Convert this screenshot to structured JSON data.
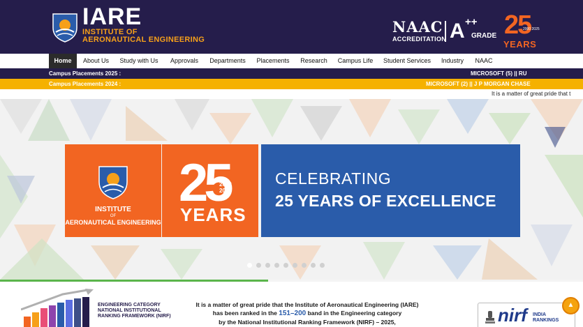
{
  "header": {
    "logo_small": "IARE",
    "logo_title": "IARE",
    "logo_line1": "INSTITUTE OF",
    "logo_line2": "AERONAUTICAL ENGINEERING",
    "naac": "NAAC",
    "naac_sub": "ACCREDITATION",
    "grade_letter": "A",
    "grade_plus": "++",
    "grade_label": "GRADE",
    "anniv_number": "25",
    "anniv_range": "2000 2025",
    "anniv_word": "YEARS"
  },
  "nav": {
    "items": [
      {
        "label": "Home",
        "active": true
      },
      {
        "label": "About Us"
      },
      {
        "label": "Study with Us"
      },
      {
        "label": "Approvals"
      },
      {
        "label": "Departments"
      },
      {
        "label": "Placements"
      },
      {
        "label": "Research"
      },
      {
        "label": "Campus Life"
      },
      {
        "label": "Student Services"
      },
      {
        "label": "Industry"
      },
      {
        "label": "NAAC"
      }
    ]
  },
  "tickers": {
    "t2025_label": "Campus Placements 2025 :",
    "t2025_text": "MICROSOFT (5)   ||   RU",
    "t2024_label_prefix": "Campus Placements ",
    "t2024_label_year": "2024",
    "t2024_label_suffix": " :",
    "t2024_text": "MICROSOFT (2)   ||   J P MORGAN CHASE"
  },
  "marquee": {
    "text": "It is a matter of great pride that t"
  },
  "banner": {
    "inst_line1": "INSTITUTE",
    "inst_line2": "OF",
    "inst_line3": "AERONAUTICAL ENGINEERING",
    "big_number": "25",
    "range_start": "2000",
    "range_end": "2025",
    "big_years": "YEARS",
    "celebrating": "CELEBRATING",
    "excellence": "25 YEARS OF EXCELLENCE",
    "slide_count": 9,
    "active_slide": 1
  },
  "slider_progress": 0.46,
  "announcement": {
    "nirf_cat": "ENGINEERING CATEGORY",
    "nirf_line2": "NATIONAL INSTITUTIONAL",
    "nirf_line3": "RANKING FRAMEWORK (NIRF)",
    "line1": "It is a matter of great pride that the Institute of Aeronautical Engineering (IARE)",
    "line2_a": "has been ranked in the ",
    "line2_hl": "151–200",
    "line2_b": " band in the Engineering category",
    "line3": "by the National Institutional Ranking Framework (NIRF) – 2025,"
  },
  "badge": {
    "nirf": "nirf",
    "india": "INDIA",
    "rankings": "RANKINGS"
  },
  "colors": {
    "header_bg": "#251d4b",
    "accent_orange": "#f26522",
    "accent_yellow": "#f5b100",
    "banner_blue": "#2a5caa"
  },
  "icons": {
    "back_to_top": "chevron-up-icon"
  }
}
